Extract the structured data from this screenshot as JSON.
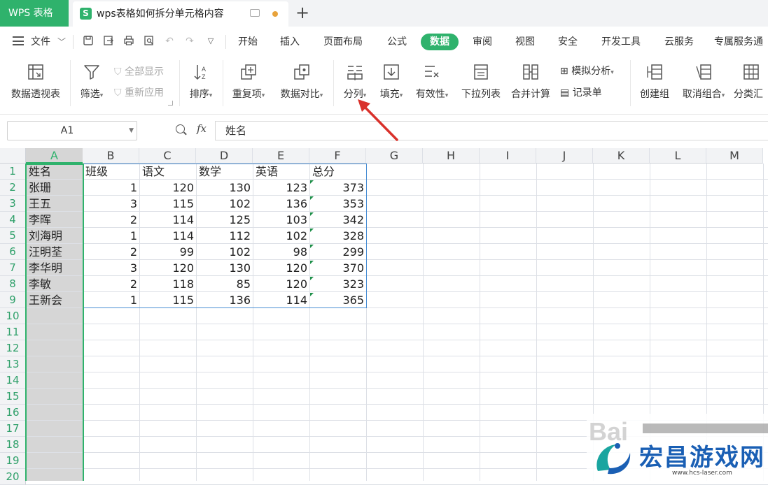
{
  "titlebar": {
    "app_tab": "WPS 表格",
    "doc_icon": "S",
    "doc_title": "wps表格如何拆分单元格内容"
  },
  "menubar": {
    "file": "文件",
    "items": [
      "开始",
      "插入",
      "页面布局",
      "公式",
      "数据",
      "审阅",
      "视图",
      "安全",
      "开发工具",
      "云服务",
      "专属服务通"
    ],
    "active": "数据"
  },
  "ribbon": {
    "pivot": "数据透视表",
    "filter": "筛选",
    "show_all": "全部显示",
    "reapply": "重新应用",
    "sort": "排序",
    "duplicates": "重复项",
    "compare": "数据对比",
    "split_column": "分列",
    "fill": "填充",
    "validity": "有效性",
    "dropdown_list": "下拉列表",
    "consolidate": "合并计算",
    "whatif": "模拟分析",
    "record": "记录单",
    "group": "创建组",
    "ungroup": "取消组合",
    "subtotal": "分类汇"
  },
  "formula_bar": {
    "name_box": "A1",
    "fx": "fx",
    "value": "姓名"
  },
  "grid": {
    "columns": [
      "A",
      "B",
      "C",
      "D",
      "E",
      "F",
      "G",
      "H",
      "I",
      "J",
      "K",
      "L",
      "M"
    ],
    "rows": [
      "1",
      "2",
      "3",
      "4",
      "5",
      "6",
      "7",
      "8",
      "9",
      "10",
      "11",
      "12",
      "13",
      "14",
      "15",
      "16",
      "17",
      "18",
      "19",
      "20"
    ],
    "header": [
      "姓名",
      "班级",
      "语文",
      "数学",
      "英语",
      "总分"
    ],
    "data": [
      [
        "张珊",
        "1",
        "120",
        "130",
        "123",
        "373"
      ],
      [
        "王五",
        "3",
        "115",
        "102",
        "136",
        "353"
      ],
      [
        "李晖",
        "2",
        "114",
        "125",
        "103",
        "342"
      ],
      [
        "刘海明",
        "1",
        "114",
        "112",
        "102",
        "328"
      ],
      [
        "汪明荃",
        "2",
        "99",
        "102",
        "98",
        "299"
      ],
      [
        "李华明",
        "3",
        "120",
        "130",
        "120",
        "370"
      ],
      [
        "李敏",
        "2",
        "118",
        "85",
        "120",
        "323"
      ],
      [
        "王新会",
        "1",
        "115",
        "136",
        "114",
        "365"
      ]
    ]
  },
  "watermark": {
    "baidu": "Bai",
    "brand": "宏昌游戏网",
    "url": "www.hcs-laser.com"
  },
  "colors": {
    "accent": "#2fb26c",
    "arrow": "#d9312b",
    "brand_blue": "#1a5fb4"
  }
}
